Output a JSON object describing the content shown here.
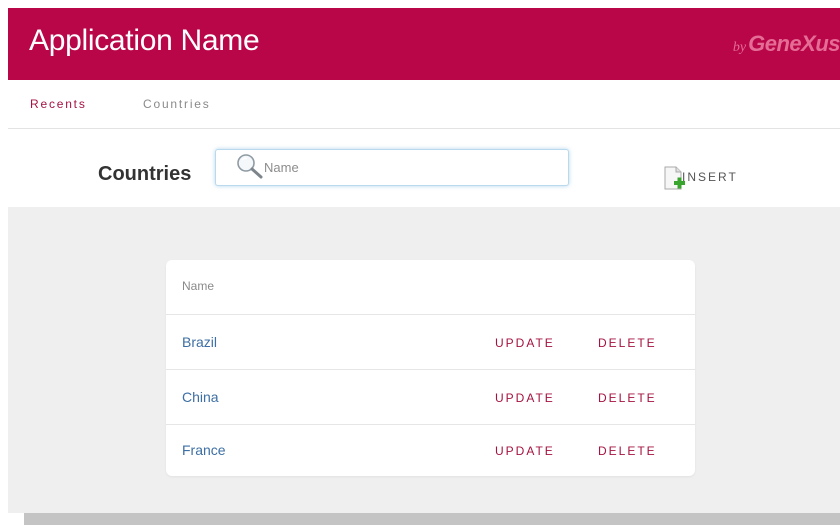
{
  "header": {
    "app_name": "Application Name",
    "brand_by": "by",
    "brand_name": "GeneXus"
  },
  "nav": {
    "items": [
      {
        "label": "Recents"
      },
      {
        "label": "Countries"
      }
    ]
  },
  "toolbar": {
    "title": "Countries",
    "search_placeholder": "Name",
    "search_value": "",
    "insert_label": "INSERT"
  },
  "table": {
    "column_header": "Name",
    "rows": [
      {
        "name": "Brazil",
        "update": "UPDATE",
        "delete": "DELETE"
      },
      {
        "name": "China",
        "update": "UPDATE",
        "delete": "DELETE"
      },
      {
        "name": "France",
        "update": "UPDATE",
        "delete": "DELETE"
      }
    ]
  },
  "colors": {
    "brand": "#b80648",
    "accent_text": "#a5123f",
    "link": "#3d6fa4",
    "background": "#efefef"
  },
  "icons": {
    "search": "search-icon",
    "insert": "insert-icon"
  }
}
